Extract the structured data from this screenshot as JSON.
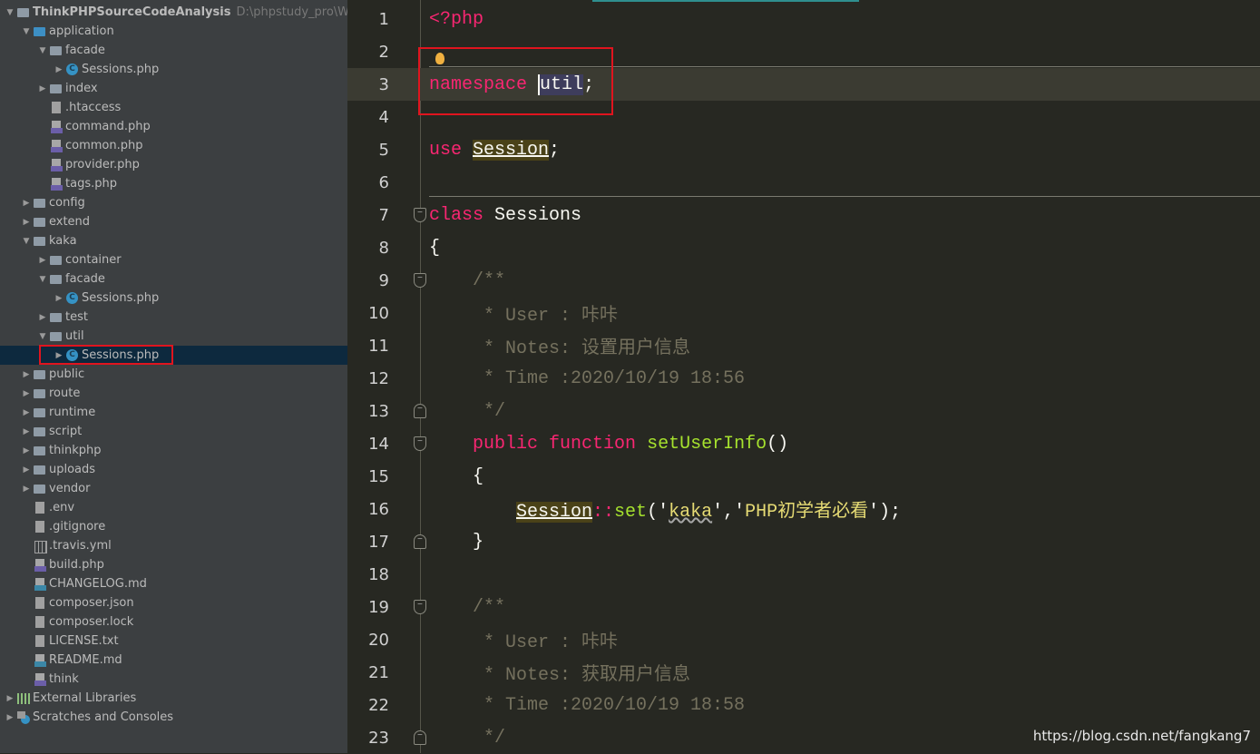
{
  "project_tree": [
    {
      "label": "ThinkPHPSourceCodeAnalysis",
      "hint": "D:\\phpstudy_pro\\WWW\\Th",
      "depth": 0,
      "arrow": "down",
      "icon": "folder-icon",
      "bold": true
    },
    {
      "label": "application",
      "depth": 1,
      "arrow": "down",
      "icon": "folder-blue-icon"
    },
    {
      "label": "facade",
      "depth": 2,
      "arrow": "down",
      "icon": "folder-icon"
    },
    {
      "label": "Sessions.php",
      "depth": 3,
      "arrow": "right",
      "icon": "class-icon"
    },
    {
      "label": "index",
      "depth": 2,
      "arrow": "right",
      "icon": "folder-icon"
    },
    {
      "label": ".htaccess",
      "depth": 2,
      "icon": "text-file-icon"
    },
    {
      "label": "command.php",
      "depth": 2,
      "icon": "php-file-icon"
    },
    {
      "label": "common.php",
      "depth": 2,
      "icon": "php-file-icon"
    },
    {
      "label": "provider.php",
      "depth": 2,
      "icon": "php-file-icon"
    },
    {
      "label": "tags.php",
      "depth": 2,
      "icon": "php-file-icon"
    },
    {
      "label": "config",
      "depth": 1,
      "arrow": "right",
      "icon": "folder-icon"
    },
    {
      "label": "extend",
      "depth": 1,
      "arrow": "right",
      "icon": "folder-icon"
    },
    {
      "label": "kaka",
      "depth": 1,
      "arrow": "down",
      "icon": "folder-icon"
    },
    {
      "label": "container",
      "depth": 2,
      "arrow": "right",
      "icon": "folder-icon"
    },
    {
      "label": "facade",
      "depth": 2,
      "arrow": "down",
      "icon": "folder-icon"
    },
    {
      "label": "Sessions.php",
      "depth": 3,
      "arrow": "right",
      "icon": "class-icon"
    },
    {
      "label": "test",
      "depth": 2,
      "arrow": "right",
      "icon": "folder-icon"
    },
    {
      "label": "util",
      "depth": 2,
      "arrow": "down",
      "icon": "folder-icon"
    },
    {
      "label": "Sessions.php",
      "depth": 3,
      "arrow": "right",
      "icon": "class-icon",
      "selected": true
    },
    {
      "label": "public",
      "depth": 1,
      "arrow": "right",
      "icon": "folder-icon"
    },
    {
      "label": "route",
      "depth": 1,
      "arrow": "right",
      "icon": "folder-icon"
    },
    {
      "label": "runtime",
      "depth": 1,
      "arrow": "right",
      "icon": "folder-icon"
    },
    {
      "label": "script",
      "depth": 1,
      "arrow": "right",
      "icon": "folder-icon"
    },
    {
      "label": "thinkphp",
      "depth": 1,
      "arrow": "right",
      "icon": "folder-icon"
    },
    {
      "label": "uploads",
      "depth": 1,
      "arrow": "right",
      "icon": "folder-icon"
    },
    {
      "label": "vendor",
      "depth": 1,
      "arrow": "right",
      "icon": "folder-icon"
    },
    {
      "label": ".env",
      "depth": 1,
      "icon": "text-file-icon"
    },
    {
      "label": ".gitignore",
      "depth": 1,
      "icon": "text-file-icon"
    },
    {
      "label": ".travis.yml",
      "depth": 1,
      "icon": "yml-file-icon"
    },
    {
      "label": "build.php",
      "depth": 1,
      "icon": "php-file-icon"
    },
    {
      "label": "CHANGELOG.md",
      "depth": 1,
      "icon": "markdown-file-icon"
    },
    {
      "label": "composer.json",
      "depth": 1,
      "icon": "json-file-icon"
    },
    {
      "label": "composer.lock",
      "depth": 1,
      "icon": "json-file-icon"
    },
    {
      "label": "LICENSE.txt",
      "depth": 1,
      "icon": "text-file-icon"
    },
    {
      "label": "README.md",
      "depth": 1,
      "icon": "markdown-file-icon"
    },
    {
      "label": "think",
      "depth": 1,
      "icon": "php-file-icon"
    },
    {
      "label": "External Libraries",
      "depth": 0,
      "arrow": "right",
      "icon": "libraries-icon"
    },
    {
      "label": "Scratches and Consoles",
      "depth": 0,
      "arrow": "right",
      "icon": "scratches-icon"
    }
  ],
  "editor": {
    "current_line": 3,
    "lines": [
      [
        [
          "kw",
          "<?php"
        ]
      ],
      [],
      [
        [
          "kw",
          "namespace"
        ],
        [
          "",
          "  "
        ],
        [
          "sel",
          "util"
        ],
        [
          "",
          ";"
        ]
      ],
      [],
      [
        [
          "kw",
          "use"
        ],
        [
          "",
          " "
        ],
        [
          "ref",
          "Session"
        ],
        [
          "",
          ";"
        ]
      ],
      [],
      [
        [
          "kw",
          "class"
        ],
        [
          "",
          " Sessions"
        ]
      ],
      [
        [
          "",
          "{"
        ]
      ],
      [
        [
          "cm",
          "    /**"
        ]
      ],
      [
        [
          "cm",
          "     * User : 咔咔"
        ]
      ],
      [
        [
          "cm",
          "     * Notes: 设置用户信息"
        ]
      ],
      [
        [
          "cm",
          "     * Time :2020/10/19 18:56"
        ]
      ],
      [
        [
          "cm",
          "     */"
        ]
      ],
      [
        [
          "",
          "    "
        ],
        [
          "kw",
          "public"
        ],
        [
          "",
          " "
        ],
        [
          "kw",
          "function"
        ],
        [
          "",
          " "
        ],
        [
          "fn",
          "setUserInfo"
        ],
        [
          "",
          "()"
        ]
      ],
      [
        [
          "",
          "    {"
        ]
      ],
      [
        [
          "",
          "        "
        ],
        [
          "ref",
          "Session"
        ],
        [
          "kw",
          "::"
        ],
        [
          "fn",
          "set"
        ],
        [
          "",
          "('"
        ],
        [
          "wavy",
          "kaka"
        ],
        [
          "",
          "','"
        ],
        [
          "st",
          "PHP初学者必看"
        ],
        [
          "",
          "');"
        ]
      ],
      [
        [
          "",
          "    }"
        ]
      ],
      [],
      [
        [
          "cm",
          "    /**"
        ]
      ],
      [
        [
          "cm",
          "     * User : 咔咔"
        ]
      ],
      [
        [
          "cm",
          "     * Notes: 获取用户信息"
        ]
      ],
      [
        [
          "cm",
          "     * Time :2020/10/19 18:58"
        ]
      ],
      [
        [
          "cm",
          "     */"
        ]
      ]
    ],
    "fold_markers": {
      "7": "down",
      "9": "down",
      "13": "up",
      "14": "down",
      "17": "up",
      "19": "down",
      "23": "up"
    }
  },
  "watermark": "https://blog.csdn.net/fangkang7",
  "colors": {
    "keyword": "#f92672",
    "function": "#a6e22e",
    "comment": "#75715e",
    "string": "#e6db74",
    "highlight_box": "#e0141e"
  }
}
